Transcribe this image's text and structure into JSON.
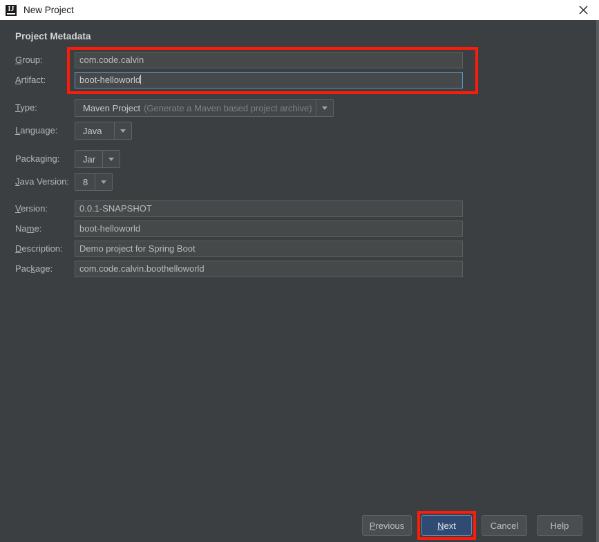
{
  "window": {
    "title": "New Project",
    "app_icon": "intellij-idea-icon",
    "icon_text": "IJ",
    "close_icon": "close-icon"
  },
  "section": {
    "title": "Project Metadata"
  },
  "colors": {
    "background": "#3c3f41",
    "field_background": "#45494a",
    "titlebar": "#ffffff",
    "accent_focus": "#5b93c7",
    "annotation_red": "#fb1c09",
    "primary_button": "#2f4b73"
  },
  "form": {
    "fields": [
      {
        "name": "group",
        "label_pre": "",
        "label_mnemonic": "G",
        "label_post": "roup:",
        "label": "Group:",
        "kind": "text",
        "value": "com.code.calvin",
        "focused": false
      },
      {
        "name": "artifact",
        "label_pre": "",
        "label_mnemonic": "A",
        "label_post": "rtifact:",
        "label": "Artifact:",
        "kind": "text",
        "value": "boot-helloworld",
        "focused": true
      },
      {
        "name": "type",
        "label_pre": "",
        "label_mnemonic": "T",
        "label_post": "ype:",
        "label": "Type:",
        "kind": "combo",
        "value": "Maven Project",
        "value_hint": "(Generate a Maven based project archive)",
        "arrow_icon": "chevron-down-icon"
      },
      {
        "name": "language",
        "label_pre": "",
        "label_mnemonic": "L",
        "label_post": "anguage:",
        "label": "Language:",
        "kind": "combo",
        "value": "Java",
        "arrow_icon": "chevron-down-icon"
      },
      {
        "name": "packaging",
        "label_pre": "Packa",
        "label_mnemonic": "g",
        "label_post": "ing:",
        "label": "Packaging:",
        "kind": "combo",
        "value": "Jar",
        "arrow_icon": "chevron-down-icon"
      },
      {
        "name": "java-version",
        "label_pre": "",
        "label_mnemonic": "J",
        "label_post": "ava Version:",
        "label": "Java Version:",
        "kind": "combo",
        "value": "8",
        "arrow_icon": "chevron-down-icon"
      },
      {
        "name": "version",
        "label_pre": "",
        "label_mnemonic": "V",
        "label_post": "ersion:",
        "label": "Version:",
        "kind": "text",
        "value": "0.0.1-SNAPSHOT",
        "focused": false
      },
      {
        "name": "project-name",
        "label_pre": "Na",
        "label_mnemonic": "m",
        "label_post": "e:",
        "label": "Name:",
        "kind": "text",
        "value": "boot-helloworld",
        "focused": false
      },
      {
        "name": "description",
        "label_pre": "",
        "label_mnemonic": "D",
        "label_post": "escription:",
        "label": "Description:",
        "kind": "text",
        "value": "Demo project for Spring Boot",
        "focused": false
      },
      {
        "name": "package",
        "label_pre": "Pac",
        "label_mnemonic": "k",
        "label_post": "age:",
        "label": "Package:",
        "kind": "text",
        "value": "com.code.calvin.boothelloworld",
        "focused": false
      }
    ]
  },
  "footer": {
    "buttons": [
      {
        "name": "previous",
        "label_pre": "",
        "label_mnemonic": "P",
        "label_post": "revious",
        "label": "Previous",
        "primary": false,
        "highlighted": false
      },
      {
        "name": "next",
        "label_pre": "",
        "label_mnemonic": "N",
        "label_post": "ext",
        "label": "Next",
        "primary": true,
        "highlighted": true
      },
      {
        "name": "cancel",
        "label_pre": "Cancel",
        "label_mnemonic": "",
        "label_post": "",
        "label": "Cancel",
        "primary": false,
        "highlighted": false
      },
      {
        "name": "help",
        "label_pre": "Help",
        "label_mnemonic": "",
        "label_post": "",
        "label": "Help",
        "primary": false,
        "highlighted": false
      }
    ]
  },
  "annotations": [
    {
      "name": "group-artifact-highlight",
      "target": "group-artifact-fields"
    },
    {
      "name": "next-button-highlight",
      "target": "next-button"
    }
  ]
}
